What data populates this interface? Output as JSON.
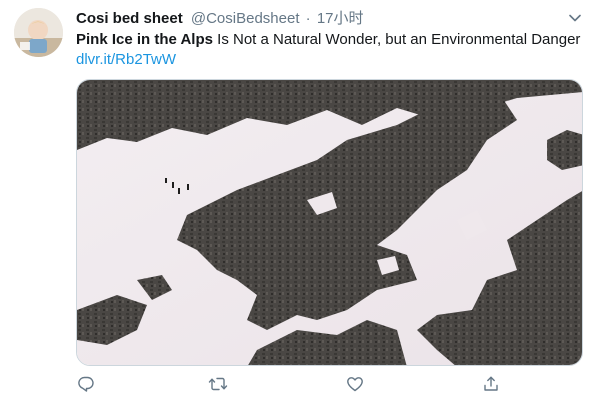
{
  "tweet": {
    "author_name": "Cosi bed sheet",
    "handle": "@CosiBedsheet",
    "separator": "·",
    "time": "17小时",
    "headline": "Pink Ice in the Alps",
    "body": " Is Not a Natural Wonder, but an Environmental Danger ",
    "link": "dlvr.it/Rb2TwW"
  },
  "icons": {
    "avatar": "avatar-image",
    "menu": "chevron-down-icon",
    "reply": "reply-icon",
    "retweet": "retweet-icon",
    "like": "heart-icon",
    "share": "share-icon"
  },
  "colors": {
    "text": "#14171a",
    "secondary": "#657786",
    "link": "#1b95e0",
    "icon": "#657786"
  }
}
